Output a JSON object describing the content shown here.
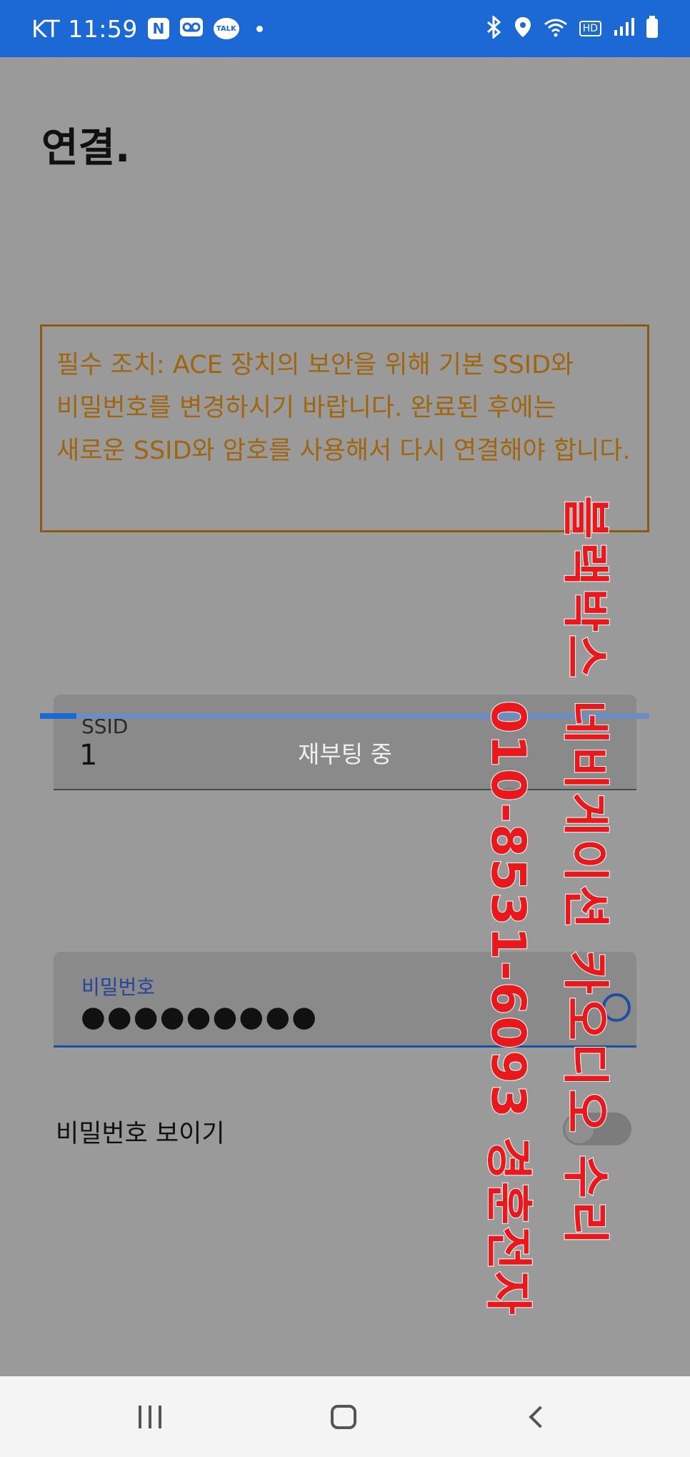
{
  "status_bar": {
    "carrier_time": "KT 11:59",
    "notif_n": "N",
    "notif_talk": "TALK",
    "hd_label": "HD"
  },
  "page": {
    "title": "연결."
  },
  "notice": {
    "text": "필수 조치: ACE 장치의 보안을 위해 기본 SSID와 비밀번호를 변경하시기 바랍니다. 완료된 후에는 새로운 SSID와 암호를 사용해서 다시 연결해야 합니다."
  },
  "ssid_field": {
    "label": "SSID",
    "value": "1"
  },
  "status": {
    "reboot_text": "재부팅 중",
    "progress_fraction": 0.06
  },
  "password_field": {
    "label": "비밀번호",
    "masked_value": "●●●●●●●●●"
  },
  "show_password": {
    "label": "비밀번호 보이기",
    "enabled": false
  },
  "watermark": {
    "line1": "블랙박스 네비게이션 카오디오 수리",
    "line2": "010-8531-6093 경훈전자",
    "color": "#e8191d"
  },
  "colors": {
    "status_bar": "#1c68d4",
    "notice_text": "#a0650f",
    "accent": "#1d4fa0"
  }
}
